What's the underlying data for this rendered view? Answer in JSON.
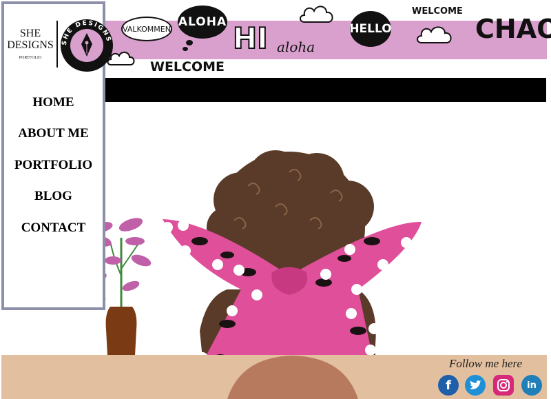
{
  "logo": {
    "line1": "SHE",
    "line2": "DESIGNS",
    "sub": "PORTFOLIO",
    "badge_text": "SHE DESIGNS"
  },
  "banner": {
    "greetings": [
      "VALKOMMEN",
      "ALOHA",
      "HI",
      "aloha",
      "HELLO",
      "WELCOME",
      "CHAO",
      "WELCOME"
    ],
    "strip_color": "#d9a0cd"
  },
  "nav": {
    "items": [
      "HOME",
      "ABOUT ME",
      "PORTFOLIO",
      "BLOG",
      "CONTACT"
    ]
  },
  "footer": {
    "follow_label": "Follow me here",
    "social": [
      {
        "name": "facebook",
        "glyph": "f",
        "color": "#1f5ea8"
      },
      {
        "name": "twitter",
        "glyph": "t",
        "color": "#1f8fd6"
      },
      {
        "name": "instagram",
        "glyph": "◎",
        "color": "#d6297a"
      },
      {
        "name": "linkedin",
        "glyph": "in",
        "color": "#1f7fb8"
      }
    ]
  },
  "colors": {
    "sidebar_border": "#8c8fa8",
    "table": "#e2bf9f",
    "scarf": "#e0509a",
    "hair": "#5a3a28"
  }
}
